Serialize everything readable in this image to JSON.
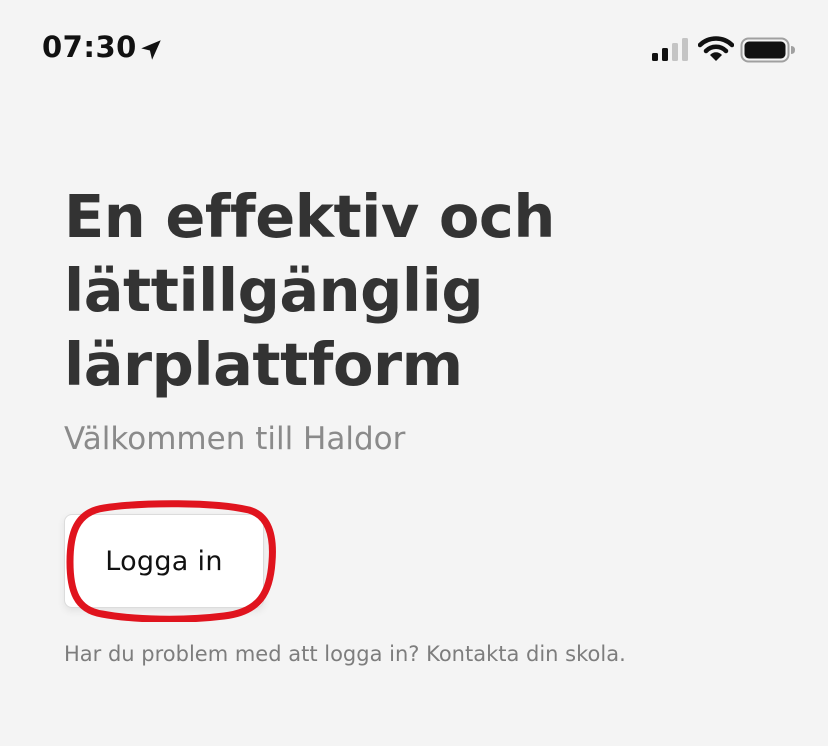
{
  "status_bar": {
    "time": "07:30",
    "icons": [
      "location-arrow-icon",
      "cellular-signal-icon",
      "wifi-icon",
      "battery-icon"
    ]
  },
  "main": {
    "headline_lines": [
      "En effektiv och",
      "lättillgänglig",
      "lärplattform"
    ],
    "subtitle": "Välkommen till Haldor",
    "login_button_label": "Logga in",
    "help_text": "Har du problem med att logga in? Kontakta din skola."
  },
  "colors": {
    "background": "#f4f4f4",
    "headline": "#333333",
    "subtitle": "#8a8a8a",
    "highlight": "#e0141e"
  }
}
